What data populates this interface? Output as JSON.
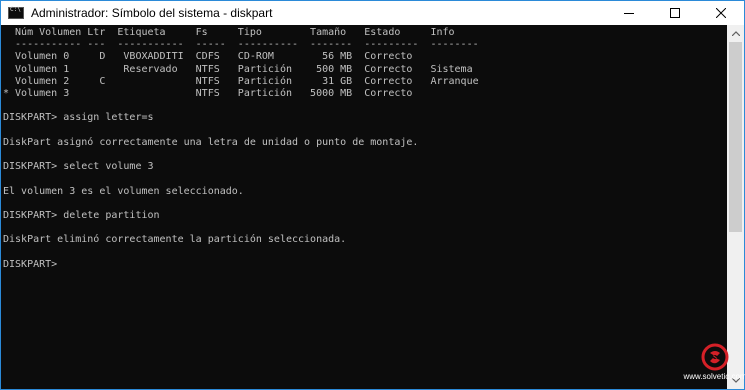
{
  "window": {
    "title": "Administrador: Símbolo del sistema - diskpart"
  },
  "icons": {
    "app": "cmd-icon",
    "minimize": "minimize-icon",
    "maximize": "maximize-icon",
    "close": "close-icon",
    "scroll_up": "chevron-up-icon",
    "scroll_down": "chevron-down-icon",
    "watermark": "solvetic-logo-icon"
  },
  "console": {
    "lines": [
      "  Núm Volumen Ltr  Etiqueta     Fs     Tipo        Tamaño   Estado     Info",
      "  ----------- ---  -----------  -----  ----------  -------  ---------  --------",
      "  Volumen 0     D   VBOXADDITI  CDFS   CD-ROM        56 MB  Correcto",
      "  Volumen 1         Reservado   NTFS   Partición    500 MB  Correcto   Sistema",
      "  Volumen 2     C               NTFS   Partición     31 GB  Correcto   Arranque",
      "* Volumen 3                     NTFS   Partición   5000 MB  Correcto",
      "",
      "DISKPART> assign letter=s",
      "",
      "DiskPart asignó correctamente una letra de unidad o punto de montaje.",
      "",
      "DISKPART> select volume 3",
      "",
      "El volumen 3 es el volumen seleccionado.",
      "",
      "DISKPART> delete partition",
      "",
      "DiskPart eliminó correctamente la partición seleccionada.",
      "",
      "DISKPART> "
    ]
  },
  "watermark": {
    "text": "www.solvetic.com"
  },
  "colors": {
    "console_bg": "#0c0c0c",
    "console_fg": "#c0c0c0",
    "border": "#2b8ad8"
  }
}
